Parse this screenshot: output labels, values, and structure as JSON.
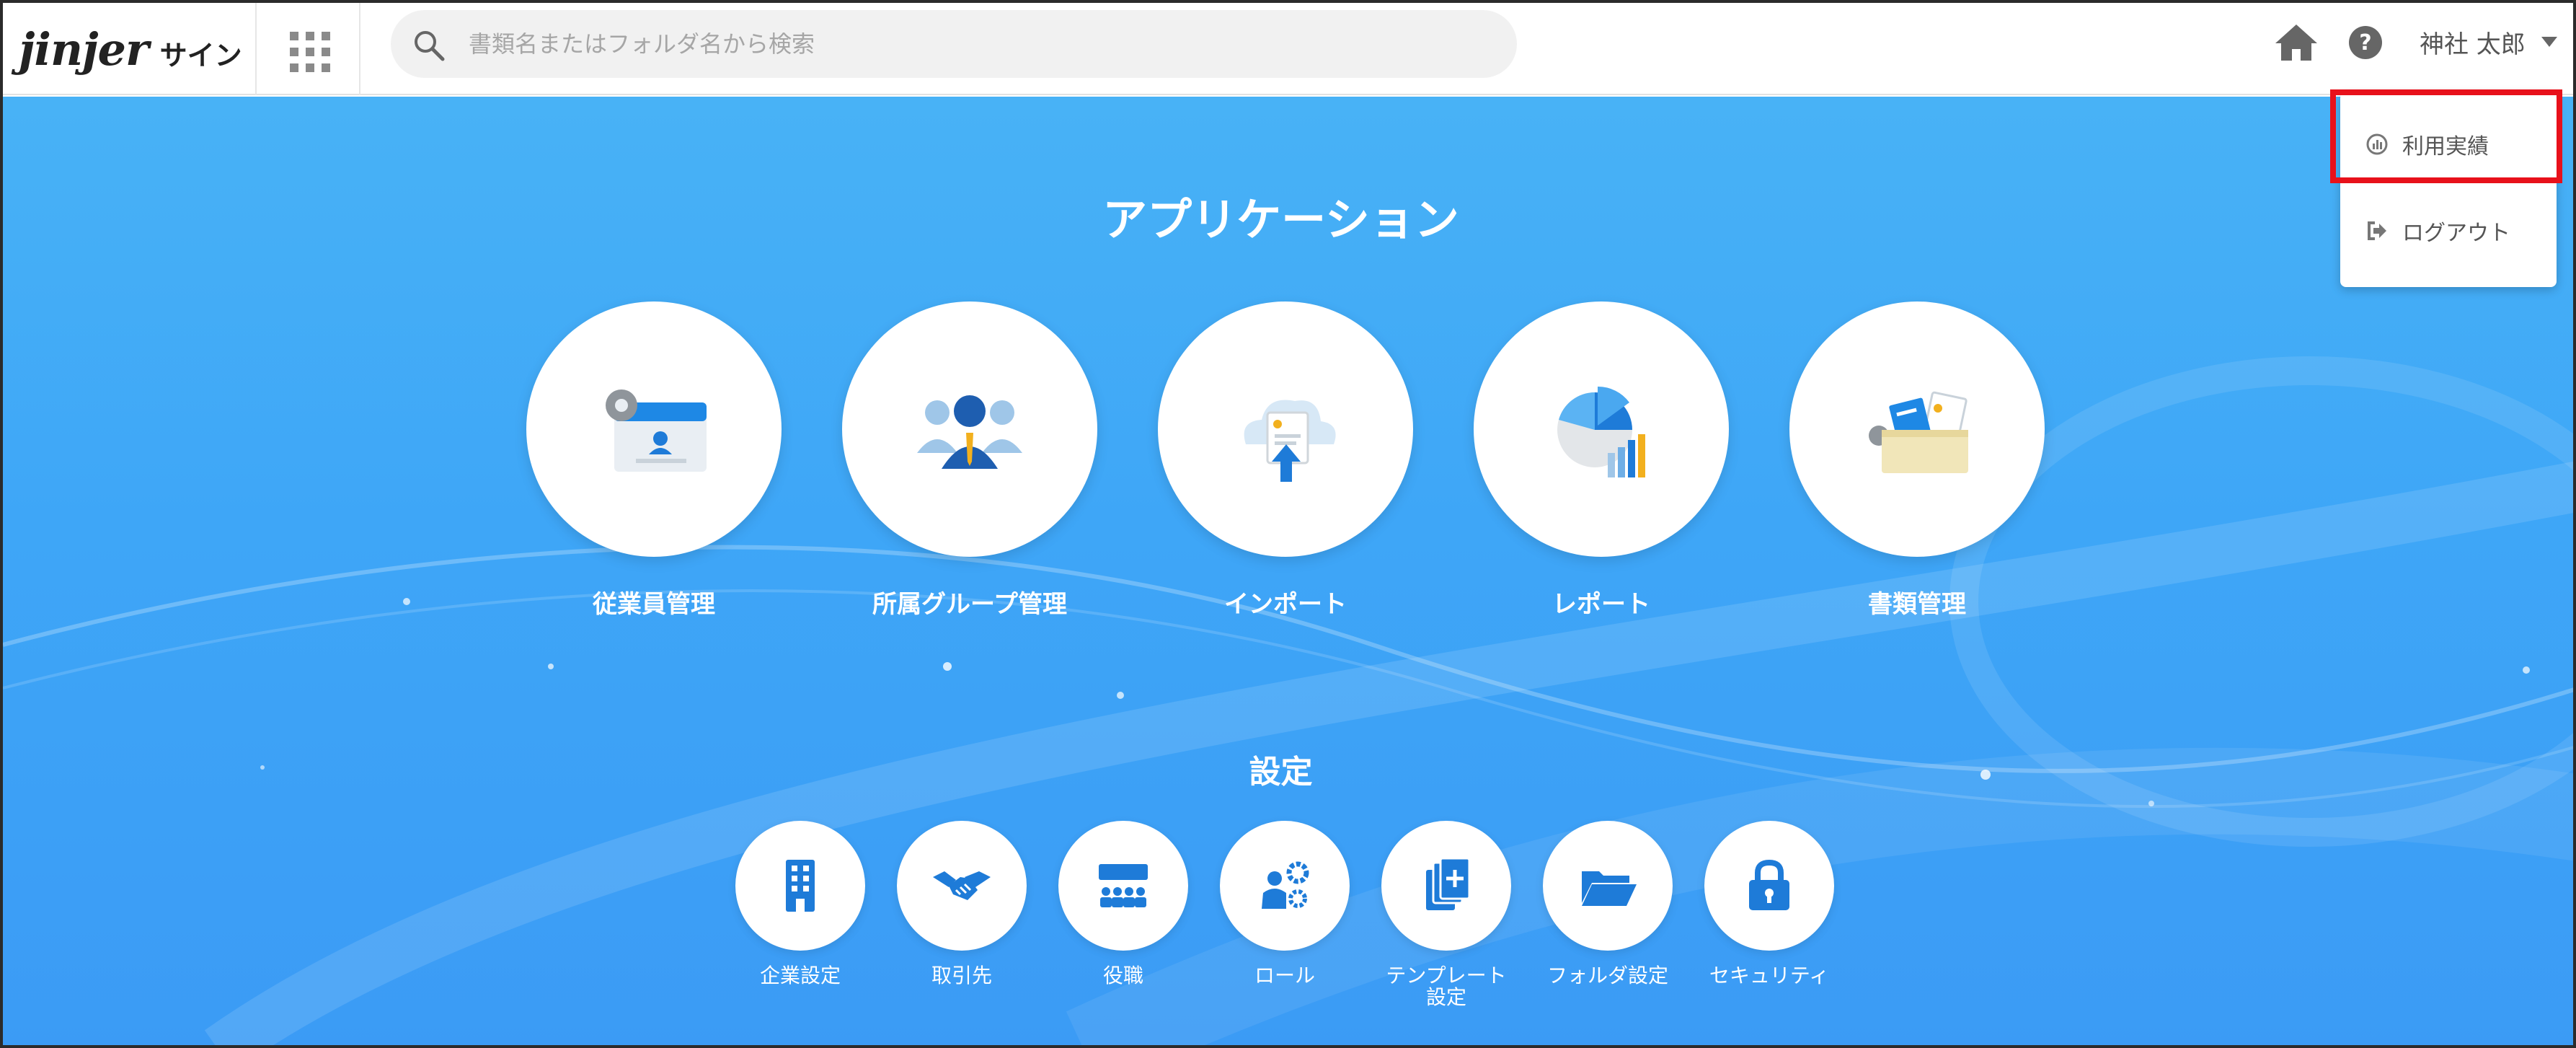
{
  "header": {
    "logo_word": "jinjer",
    "logo_sub": "サイン",
    "search_placeholder": "書類名またはフォルダ名から検索",
    "user_name": "神社 太郎"
  },
  "applications": {
    "title": "アプリケーション",
    "items": [
      {
        "label": "従業員管理",
        "icon": "employee-card-icon"
      },
      {
        "label": "所属グループ管理",
        "icon": "group-people-icon"
      },
      {
        "label": "インポート",
        "icon": "cloud-upload-icon"
      },
      {
        "label": "レポート",
        "icon": "pie-chart-icon"
      },
      {
        "label": "書類管理",
        "icon": "document-folder-icon"
      }
    ]
  },
  "settings": {
    "title": "設定",
    "items": [
      {
        "label": "企業設定",
        "icon": "building-icon"
      },
      {
        "label": "取引先",
        "icon": "handshake-icon"
      },
      {
        "label": "役職",
        "icon": "org-chart-icon"
      },
      {
        "label": "ロール",
        "icon": "user-gear-icon"
      },
      {
        "label": "テンプレート\n設定",
        "icon": "template-copy-icon"
      },
      {
        "label": "フォルダ設定",
        "icon": "folder-open-icon"
      },
      {
        "label": "セキュリティ",
        "icon": "lock-icon"
      }
    ]
  },
  "user_dropdown": {
    "items": [
      {
        "label": "利用実績",
        "icon": "usage-chart-icon"
      },
      {
        "label": "ログアウト",
        "icon": "logout-icon"
      }
    ]
  },
  "colors": {
    "accent": "#3ea6f7",
    "icon_blue": "#1e7bd8",
    "highlight": "#e8111b"
  }
}
